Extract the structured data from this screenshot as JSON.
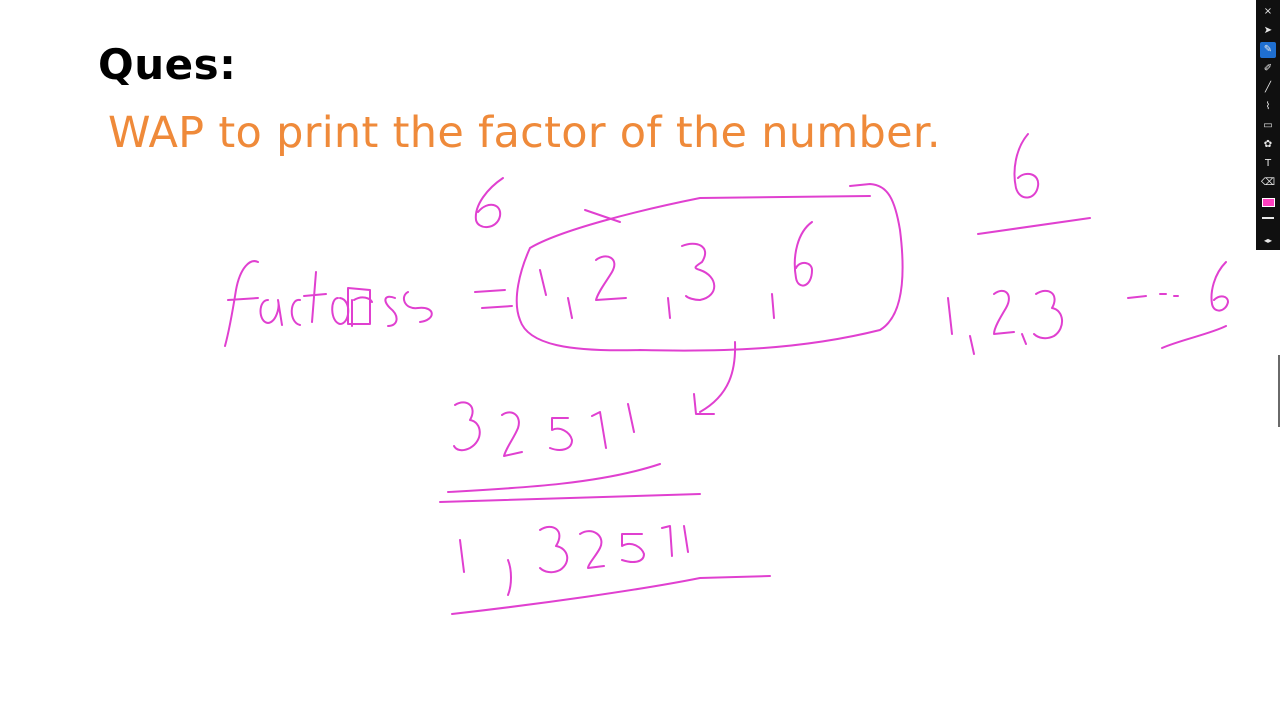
{
  "slide": {
    "heading": "Ques:",
    "question": "WAP to print the factor of the number."
  },
  "annotations": {
    "ink_color": "#e040d0"
  },
  "toolbar": {
    "active_color": "#ff40c0",
    "tools": [
      {
        "name": "close-icon",
        "glyph": "×"
      },
      {
        "name": "select-arrow-icon",
        "glyph": "➤"
      },
      {
        "name": "pen-icon",
        "glyph": "✎",
        "active": true
      },
      {
        "name": "marker-icon",
        "glyph": "✐"
      },
      {
        "name": "line-icon",
        "glyph": "╱"
      },
      {
        "name": "brush-icon",
        "glyph": "⌇"
      },
      {
        "name": "rectangle-icon",
        "glyph": "▭"
      },
      {
        "name": "stamp-icon",
        "glyph": "✿"
      },
      {
        "name": "text-icon",
        "glyph": "T"
      },
      {
        "name": "eraser-icon",
        "glyph": "⌫"
      }
    ]
  }
}
